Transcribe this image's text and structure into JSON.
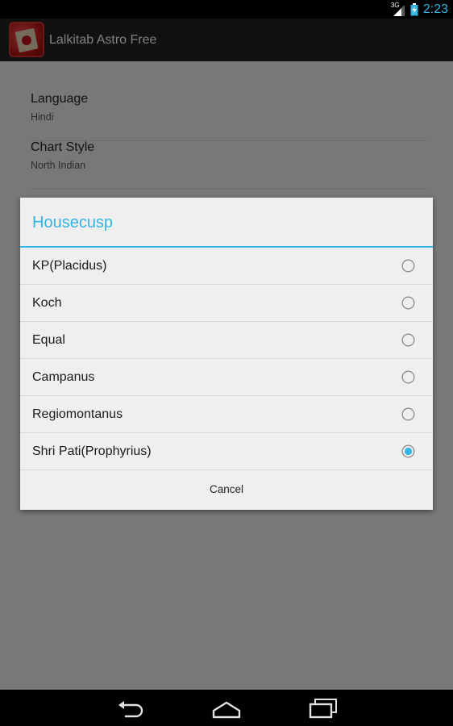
{
  "status_bar": {
    "network_type": "3G",
    "time": "2:23"
  },
  "app": {
    "title": "Lalkitab Astro Free"
  },
  "settings": {
    "items": [
      {
        "title": "Language",
        "summary": "Hindi"
      },
      {
        "title": "Chart Style",
        "summary": "North Indian"
      }
    ]
  },
  "dialog": {
    "title": "Housecusp",
    "options": [
      {
        "label": "KP(Placidus)",
        "selected": false
      },
      {
        "label": "Koch",
        "selected": false
      },
      {
        "label": "Equal",
        "selected": false
      },
      {
        "label": "Campanus",
        "selected": false
      },
      {
        "label": "Regiomontanus",
        "selected": false
      },
      {
        "label": "Shri Pati(Prophyrius)",
        "selected": true
      }
    ],
    "cancel_label": "Cancel"
  },
  "colors": {
    "accent": "#33b5e5",
    "dialog_bg": "#efefef",
    "status_bar_bg": "#000000"
  },
  "icons": {
    "signal": "signal-icon",
    "battery": "battery-charging-icon",
    "back": "back-icon",
    "home": "home-icon",
    "recents": "recent-apps-icon"
  }
}
